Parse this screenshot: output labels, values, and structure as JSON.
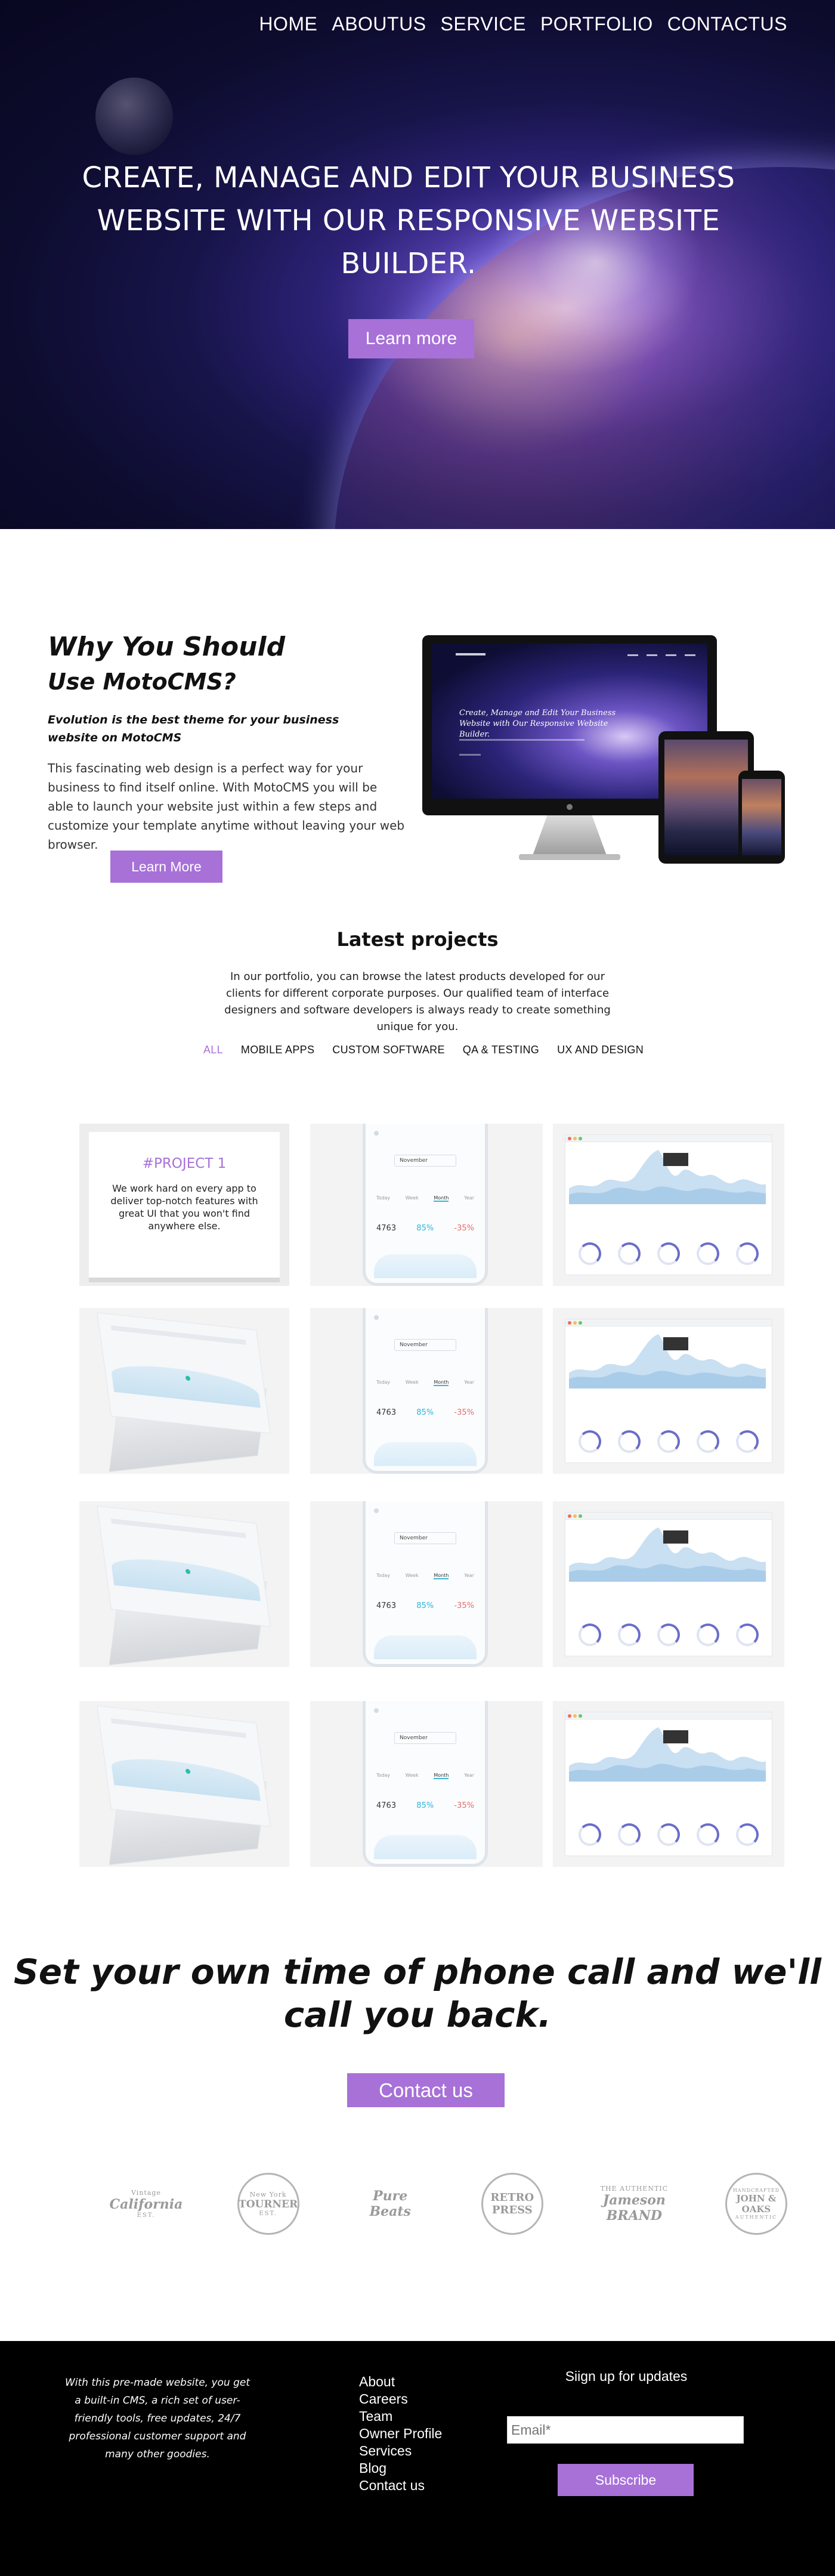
{
  "nav": {
    "items": [
      "HOME",
      "ABOUTUS",
      "SERVICE",
      "PORTFOLIO",
      "CONTACTUS"
    ]
  },
  "hero": {
    "title": "CREATE, MANAGE AND EDIT YOUR BUSINESS WEBSITE WITH OUR RESPONSIVE WEBSITE BUILDER.",
    "button": "Learn more"
  },
  "why": {
    "title_line1": "Why You Should",
    "title_line2": "Use MotoCMS?",
    "subtitle": "Evolution is the best theme for your business website on MotoCMS",
    "body": "This fascinating web design is a perfect way for your business to find itself online. With MotoCMS you will be able to launch your website just within a few steps and customize your template anytime without leaving your web browser.",
    "button": "Learn More",
    "device_headline": "Create, Manage and Edit Your Business Website with Our Responsive Website Builder."
  },
  "projects": {
    "title": "Latest projects",
    "body": "In our portfolio, you can browse the latest products developed for our clients for different corporate purposes. Our qualified team of interface designers and software developers is always ready to create something unique for you.",
    "filters": [
      "ALL",
      "MOBILE APPS",
      "CUSTOM SOFTWARE",
      "QA & TESTING",
      "UX AND DESIGN"
    ],
    "active_filter": "ALL",
    "card": {
      "title": "#PROJECT 1",
      "text": "We work hard on every app to deliver top-notch features with great UI that you won't find anywhere else."
    },
    "phone_mock": {
      "select": "November",
      "tabs": [
        "Today",
        "Week",
        "Month",
        "Year"
      ],
      "stats": [
        "4763",
        "85%",
        "-35%"
      ]
    },
    "tiles": [
      {
        "type": "card"
      },
      {
        "type": "phone"
      },
      {
        "type": "dashboard"
      },
      {
        "type": "laptop"
      },
      {
        "type": "phone"
      },
      {
        "type": "dashboard"
      },
      {
        "type": "laptop"
      },
      {
        "type": "phone"
      },
      {
        "type": "dashboard"
      },
      {
        "type": "laptop"
      },
      {
        "type": "phone"
      },
      {
        "type": "dashboard"
      }
    ]
  },
  "cta": {
    "title": "Set your own time of phone call and we'll call you back.",
    "button": "Contact us"
  },
  "logos": [
    {
      "top": "Vintage",
      "main": "California",
      "bottom": "EST."
    },
    {
      "top": "New York",
      "main": "TOURNER",
      "bottom": "EST."
    },
    {
      "top": "",
      "main": "Pure Beats",
      "bottom": ""
    },
    {
      "top": "",
      "main": "RETRO PRESS",
      "bottom": ""
    },
    {
      "top": "THE AUTHENTIC",
      "main": "Jameson BRAND",
      "bottom": ""
    },
    {
      "top": "HANDCRAFTED",
      "main": "JOHN & OAKS",
      "bottom": "AUTHENTIC"
    }
  ],
  "footer": {
    "about": "With this pre-made website, you get a built-in CMS, a rich set of user-friendly tools, free updates, 24/7 professional customer support and many other goodies.",
    "links": [
      "About",
      "Careers",
      "Team",
      "Owner Profile",
      "Services",
      "Blog",
      "Contact us"
    ],
    "signup_title": "Siign up for updates",
    "email_placeholder": "Email*",
    "subscribe": "Subscribe"
  },
  "colors": {
    "accent": "#a771d8",
    "footer_bg": "#000000",
    "hero_bg": "#171449"
  }
}
